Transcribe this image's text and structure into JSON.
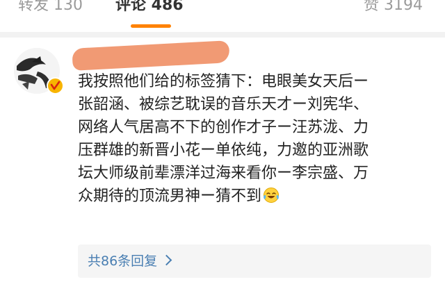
{
  "tabs": {
    "repost": "转发 130",
    "comments": "评论 486",
    "likes": "赞 3194"
  },
  "comment": {
    "lines": [
      "我按照他们给的标签猜下：电眼美女天后ー",
      "张韶涵、被综艺耽误的音乐天才ー刘宪华、",
      "网络人气居高不下的创作才子ー汪苏泷、力",
      "压群雄的新晋小花ー单依纯，力邀的亚洲歌",
      "坛大师级前辈漂洋过海来看你ー李宗盛、万",
      "众期待的顶流男神ー猜不到"
    ],
    "emoji": "laughing-with-tears-icon",
    "replies_link": "共86条回复"
  },
  "colors": {
    "accent": "#ff8200",
    "link": "#4a7fb2",
    "muted": "#9a9a9a",
    "redaction": "#f19a74"
  }
}
